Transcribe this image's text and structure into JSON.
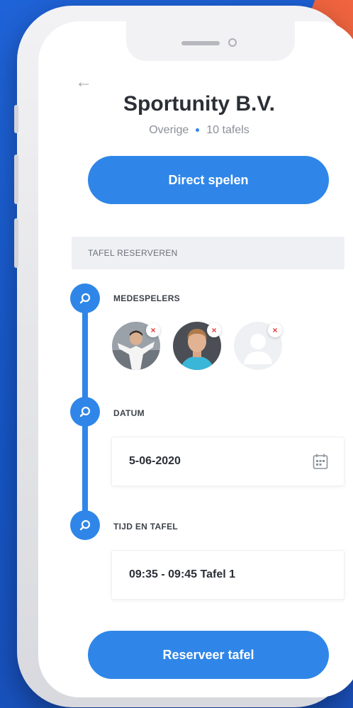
{
  "header": {
    "back_icon": "arrow-left-icon",
    "title": "Sportunity B.V.",
    "category": "Overige",
    "tables": "10 tafels"
  },
  "actions": {
    "direct_play": "Direct spelen",
    "reserve": "Reserveer tafel"
  },
  "reservation": {
    "section_title": "TAFEL RESERVEREN",
    "steps": [
      {
        "label": "MEDESPELERS",
        "icon": "search-icon"
      },
      {
        "label": "DATUM",
        "icon": "search-icon"
      },
      {
        "label": "TIJD EN TAFEL",
        "icon": "search-icon"
      }
    ],
    "players": [
      {
        "type": "photo",
        "remove_icon": "close-icon"
      },
      {
        "type": "photo",
        "remove_icon": "close-icon"
      },
      {
        "type": "placeholder",
        "remove_icon": "close-icon"
      }
    ],
    "date_value": "5-06-2020",
    "date_icon": "calendar-icon",
    "time_value": "09:35 - 09:45 Tafel 1"
  },
  "colors": {
    "primary": "#2f86e8",
    "background": "#1f63d8",
    "accent": "#f0643f",
    "remove": "#e23b3b"
  }
}
